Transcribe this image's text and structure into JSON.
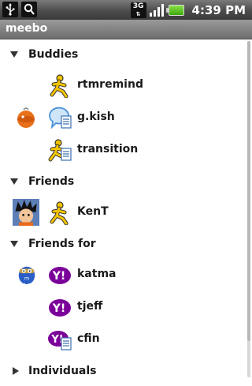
{
  "status_bar": {
    "network": "3G",
    "time": "4:39 PM",
    "icons": [
      "usb-icon",
      "notification-icon",
      "network-3g-icon",
      "signal-icon",
      "battery-icon"
    ]
  },
  "app": {
    "title": "meebo"
  },
  "groups": [
    {
      "label": "Buddies",
      "expanded": true,
      "buddies": [
        {
          "name": "rtmremind",
          "network": "aim",
          "has_avatar": false,
          "idle": false
        },
        {
          "name": "g.kish",
          "network": "gtalk",
          "has_avatar": true,
          "idle": true
        },
        {
          "name": "transition",
          "network": "aim",
          "has_avatar": false,
          "idle": true
        }
      ]
    },
    {
      "label": "Friends",
      "expanded": true,
      "buddies": [
        {
          "name": "KenT",
          "network": "aim",
          "has_avatar": true,
          "idle": false
        }
      ]
    },
    {
      "label": "Friends for",
      "expanded": true,
      "buddies": [
        {
          "name": "katma",
          "network": "yahoo",
          "has_avatar": true,
          "idle": false
        },
        {
          "name": "tjeff",
          "network": "yahoo",
          "has_avatar": false,
          "idle": false
        },
        {
          "name": "cfin",
          "network": "yahoo",
          "has_avatar": false,
          "idle": true
        }
      ]
    },
    {
      "label": "Individuals",
      "expanded": false,
      "buddies": []
    }
  ],
  "colors": {
    "aim_yellow": "#f5c400",
    "yahoo_purple": "#7b0099",
    "gtalk_blue": "#4a90d9"
  }
}
